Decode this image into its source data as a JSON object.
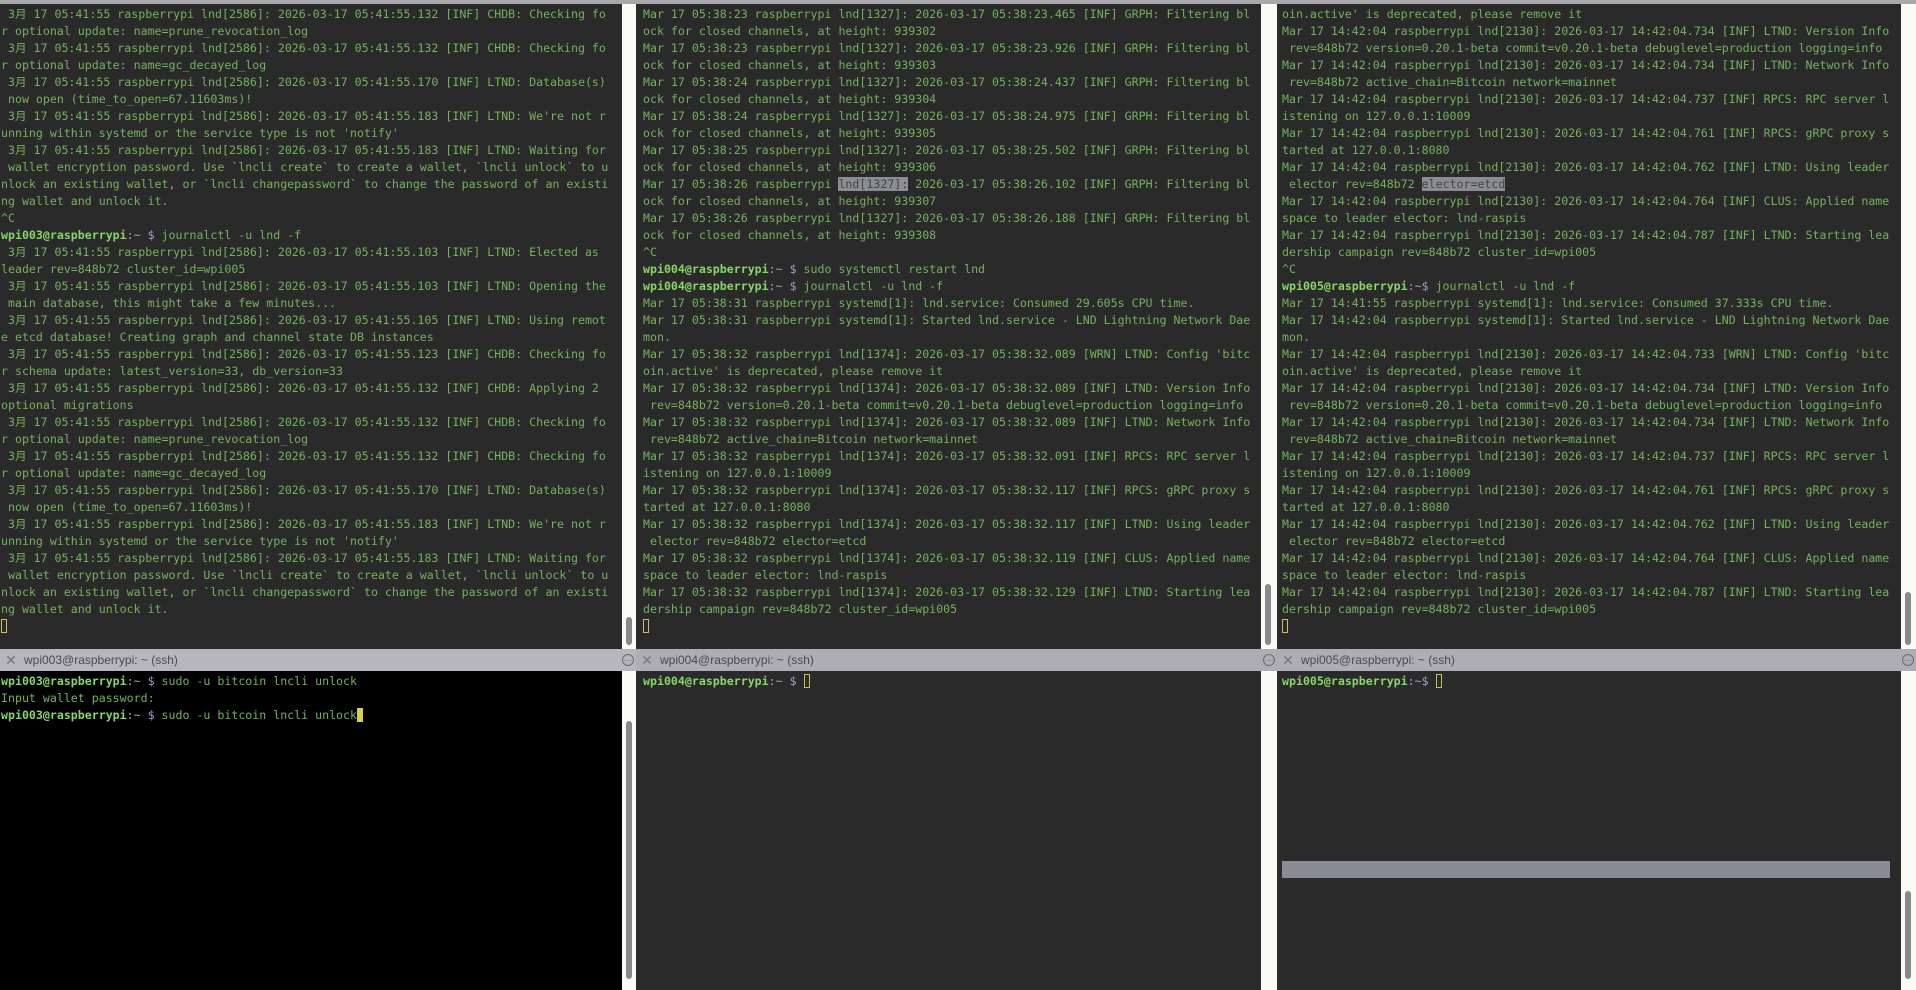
{
  "colors": {
    "text": "#72b45a",
    "prompt_user": "#86d766",
    "prompt_path": "#a4a2c4",
    "background": "#2a2a2b",
    "cursor": "#c9c060"
  },
  "panes": {
    "top_left": {
      "lines": [
        " 3月 17 05:41:55 raspberrypi lnd[2586]: 2026-03-17 05:41:55.132 [INF] CHDB: Checking fo",
        "r optional update: name=prune_revocation_log",
        " 3月 17 05:41:55 raspberrypi lnd[2586]: 2026-03-17 05:41:55.132 [INF] CHDB: Checking fo",
        "r optional update: name=gc_decayed_log",
        " 3月 17 05:41:55 raspberrypi lnd[2586]: 2026-03-17 05:41:55.170 [INF] LTND: Database(s)",
        " now open (time_to_open=67.11603ms)!",
        " 3月 17 05:41:55 raspberrypi lnd[2586]: 2026-03-17 05:41:55.183 [INF] LTND: We're not r",
        "unning within systemd or the service type is not 'notify'",
        " 3月 17 05:41:55 raspberrypi lnd[2586]: 2026-03-17 05:41:55.183 [INF] LTND: Waiting for",
        " wallet encryption password. Use `lncli create` to create a wallet, `lncli unlock` to u",
        "nlock an existing wallet, or `lncli changepassword` to change the password of an existi",
        "ng wallet and unlock it.",
        "^C",
        {
          "user": "wpi003@raspberrypi",
          "path": ":~ $ ",
          "cmd": "journalctl -u lnd -f"
        },
        " 3月 17 05:41:55 raspberrypi lnd[2586]: 2026-03-17 05:41:55.103 [INF] LTND: Elected as",
        "leader rev=848b72 cluster_id=wpi005",
        " 3月 17 05:41:55 raspberrypi lnd[2586]: 2026-03-17 05:41:55.103 [INF] LTND: Opening the",
        " main database, this might take a few minutes...",
        " 3月 17 05:41:55 raspberrypi lnd[2586]: 2026-03-17 05:41:55.105 [INF] LTND: Using remot",
        "e etcd database! Creating graph and channel state DB instances",
        " 3月 17 05:41:55 raspberrypi lnd[2586]: 2026-03-17 05:41:55.123 [INF] CHDB: Checking fo",
        "r schema update: latest_version=33, db_version=33",
        " 3月 17 05:41:55 raspberrypi lnd[2586]: 2026-03-17 05:41:55.132 [INF] CHDB: Applying 2",
        "optional migrations",
        " 3月 17 05:41:55 raspberrypi lnd[2586]: 2026-03-17 05:41:55.132 [INF] CHDB: Checking fo",
        "r optional update: name=prune_revocation_log",
        " 3月 17 05:41:55 raspberrypi lnd[2586]: 2026-03-17 05:41:55.132 [INF] CHDB: Checking fo",
        "r optional update: name=gc_decayed_log",
        " 3月 17 05:41:55 raspberrypi lnd[2586]: 2026-03-17 05:41:55.170 [INF] LTND: Database(s)",
        " now open (time_to_open=67.11603ms)!",
        " 3月 17 05:41:55 raspberrypi lnd[2586]: 2026-03-17 05:41:55.183 [INF] LTND: We're not r",
        "unning within systemd or the service type is not 'notify'",
        " 3月 17 05:41:55 raspberrypi lnd[2586]: 2026-03-17 05:41:55.183 [INF] LTND: Waiting for",
        " wallet encryption password. Use `lncli create` to create a wallet, `lncli unlock` to u",
        "nlock an existing wallet, or `lncli changepassword` to change the password of an existi",
        "ng wallet and unlock it.",
        {
          "cursor": "hollow"
        }
      ]
    },
    "top_middle": {
      "lines": [
        "Mar 17 05:38:23 raspberrypi lnd[1327]: 2026-03-17 05:38:23.465 [INF] GRPH: Filtering bl",
        "ock for closed channels, at height: 939302",
        "Mar 17 05:38:23 raspberrypi lnd[1327]: 2026-03-17 05:38:23.926 [INF] GRPH: Filtering bl",
        "ock for closed channels, at height: 939303",
        "Mar 17 05:38:24 raspberrypi lnd[1327]: 2026-03-17 05:38:24.437 [INF] GRPH: Filtering bl",
        "ock for closed channels, at height: 939304",
        "Mar 17 05:38:24 raspberrypi lnd[1327]: 2026-03-17 05:38:24.975 [INF] GRPH: Filtering bl",
        "ock for closed channels, at height: 939305",
        "Mar 17 05:38:25 raspberrypi lnd[1327]: 2026-03-17 05:38:25.502 [INF] GRPH: Filtering bl",
        "ock for closed channels, at height: 939306",
        {
          "pre": "Mar 17 05:38:26 raspberrypi ",
          "hl": "lnd[1327]:",
          "post": " 2026-03-17 05:38:26.102 [INF] GRPH: Filtering bl"
        },
        "ock for closed channels, at height: 939307",
        "Mar 17 05:38:26 raspberrypi lnd[1327]: 2026-03-17 05:38:26.188 [INF] GRPH: Filtering bl",
        "ock for closed channels, at height: 939308",
        "^C",
        {
          "user": "wpi004@raspberrypi",
          "path": ":~ $ ",
          "cmd": "sudo systemctl restart lnd"
        },
        {
          "user": "wpi004@raspberrypi",
          "path": ":~ $ ",
          "cmd": "journalctl -u lnd -f"
        },
        "Mar 17 05:38:31 raspberrypi systemd[1]: lnd.service: Consumed 29.605s CPU time.",
        "Mar 17 05:38:31 raspberrypi systemd[1]: Started lnd.service - LND Lightning Network Dae",
        "mon.",
        "Mar 17 05:38:32 raspberrypi lnd[1374]: 2026-03-17 05:38:32.089 [WRN] LTND: Config 'bitc",
        "oin.active' is deprecated, please remove it",
        "Mar 17 05:38:32 raspberrypi lnd[1374]: 2026-03-17 05:38:32.089 [INF] LTND: Version Info",
        " rev=848b72 version=0.20.1-beta commit=v0.20.1-beta debuglevel=production logging=info",
        "Mar 17 05:38:32 raspberrypi lnd[1374]: 2026-03-17 05:38:32.089 [INF] LTND: Network Info",
        " rev=848b72 active_chain=Bitcoin network=mainnet",
        "Mar 17 05:38:32 raspberrypi lnd[1374]: 2026-03-17 05:38:32.091 [INF] RPCS: RPC server l",
        "istening on 127.0.0.1:10009",
        "Mar 17 05:38:32 raspberrypi lnd[1374]: 2026-03-17 05:38:32.117 [INF] RPCS: gRPC proxy s",
        "tarted at 127.0.0.1:8080",
        "Mar 17 05:38:32 raspberrypi lnd[1374]: 2026-03-17 05:38:32.117 [INF] LTND: Using leader",
        " elector rev=848b72 elector=etcd",
        "Mar 17 05:38:32 raspberrypi lnd[1374]: 2026-03-17 05:38:32.119 [INF] CLUS: Applied name",
        "space to leader elector: lnd-raspis",
        "Mar 17 05:38:32 raspberrypi lnd[1374]: 2026-03-17 05:38:32.129 [INF] LTND: Starting lea",
        "dership campaign rev=848b72 cluster_id=wpi005",
        {
          "cursor": "hollow"
        }
      ]
    },
    "top_right": {
      "lines": [
        "oin.active' is deprecated, please remove it",
        "Mar 17 14:42:04 raspberrypi lnd[2130]: 2026-03-17 14:42:04.734 [INF] LTND: Version Info",
        " rev=848b72 version=0.20.1-beta commit=v0.20.1-beta debuglevel=production logging=info",
        "Mar 17 14:42:04 raspberrypi lnd[2130]: 2026-03-17 14:42:04.734 [INF] LTND: Network Info",
        " rev=848b72 active_chain=Bitcoin network=mainnet",
        "Mar 17 14:42:04 raspberrypi lnd[2130]: 2026-03-17 14:42:04.737 [INF] RPCS: RPC server l",
        "istening on 127.0.0.1:10009",
        "Mar 17 14:42:04 raspberrypi lnd[2130]: 2026-03-17 14:42:04.761 [INF] RPCS: gRPC proxy s",
        "tarted at 127.0.0.1:8080",
        "Mar 17 14:42:04 raspberrypi lnd[2130]: 2026-03-17 14:42:04.762 [INF] LTND: Using leader",
        {
          "pre": " elector rev=848b72 ",
          "hl": "elector=etcd",
          "post": ""
        },
        "Mar 17 14:42:04 raspberrypi lnd[2130]: 2026-03-17 14:42:04.764 [INF] CLUS: Applied name",
        "space to leader elector: lnd-raspis",
        "Mar 17 14:42:04 raspberrypi lnd[2130]: 2026-03-17 14:42:04.787 [INF] LTND: Starting lea",
        "dership campaign rev=848b72 cluster_id=wpi005",
        "^C",
        {
          "user": "wpi005@raspberrypi",
          "path": ":~$ ",
          "cmd": "journalctl -u lnd -f"
        },
        "Mar 17 14:41:55 raspberrypi systemd[1]: lnd.service: Consumed 37.333s CPU time.",
        "Mar 17 14:42:04 raspberrypi systemd[1]: Started lnd.service - LND Lightning Network Dae",
        "mon.",
        "Mar 17 14:42:04 raspberrypi lnd[2130]: 2026-03-17 14:42:04.733 [WRN] LTND: Config 'bitc",
        "oin.active' is deprecated, please remove it",
        "Mar 17 14:42:04 raspberrypi lnd[2130]: 2026-03-17 14:42:04.734 [INF] LTND: Version Info",
        " rev=848b72 version=0.20.1-beta commit=v0.20.1-beta debuglevel=production logging=info",
        "Mar 17 14:42:04 raspberrypi lnd[2130]: 2026-03-17 14:42:04.734 [INF] LTND: Network Info",
        " rev=848b72 active_chain=Bitcoin network=mainnet",
        "Mar 17 14:42:04 raspberrypi lnd[2130]: 2026-03-17 14:42:04.737 [INF] RPCS: RPC server l",
        "istening on 127.0.0.1:10009",
        "Mar 17 14:42:04 raspberrypi lnd[2130]: 2026-03-17 14:42:04.761 [INF] RPCS: gRPC proxy s",
        "tarted at 127.0.0.1:8080",
        "Mar 17 14:42:04 raspberrypi lnd[2130]: 2026-03-17 14:42:04.762 [INF] LTND: Using leader",
        " elector rev=848b72 elector=etcd",
        "Mar 17 14:42:04 raspberrypi lnd[2130]: 2026-03-17 14:42:04.764 [INF] CLUS: Applied name",
        "space to leader elector: lnd-raspis",
        "Mar 17 14:42:04 raspberrypi lnd[2130]: 2026-03-17 14:42:04.787 [INF] LTND: Starting lea",
        "dership campaign rev=848b72 cluster_id=wpi005",
        {
          "cursor": "hollow"
        }
      ]
    },
    "bottom_left": {
      "lines": [
        {
          "user": "wpi003@raspberrypi",
          "path": ":~ $ ",
          "cmd": "sudo -u bitcoin lncli unlock"
        },
        "Input wallet password:",
        {
          "user": "wpi003@raspberrypi",
          "path": ":~ $ ",
          "cmd": "sudo -u bitcoin lncli unlock",
          "cursor": "filled"
        }
      ]
    },
    "bottom_middle": {
      "lines": [
        {
          "user": "wpi004@raspberrypi",
          "path": ":~ $ ",
          "cmd": "",
          "cursor": "hollow"
        }
      ]
    },
    "bottom_right": {
      "lines": [
        {
          "user": "wpi005@raspberrypi",
          "path": ":~$ ",
          "cmd": "",
          "cursor": "hollow"
        }
      ]
    }
  },
  "tabs": [
    {
      "title": "wpi003@raspberrypi: ~ (ssh)",
      "close_icon": "close-icon",
      "menu_icon": "more-icon"
    },
    {
      "title": "wpi004@raspberrypi: ~ (ssh)",
      "close_icon": "close-icon",
      "menu_icon": "more-icon"
    },
    {
      "title": "wpi005@raspberrypi: ~ (ssh)",
      "close_icon": "close-icon",
      "menu_icon": "more-icon"
    }
  ]
}
